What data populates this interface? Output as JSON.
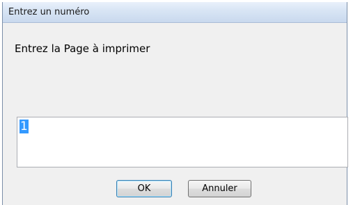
{
  "window": {
    "title": "Entrez un numéro"
  },
  "prompt": {
    "label": "Entrez la Page à imprimer"
  },
  "input": {
    "value": "1",
    "selected": true
  },
  "buttons": {
    "ok_label": "OK",
    "cancel_label": "Annuler"
  },
  "colors": {
    "dialog_background": "#f0f0f0",
    "titlebar_top": "#e9f1fb",
    "titlebar_bottom": "#c9d9ee",
    "selection_highlight": "#3399ff",
    "default_button_border": "#3c7fb1"
  }
}
